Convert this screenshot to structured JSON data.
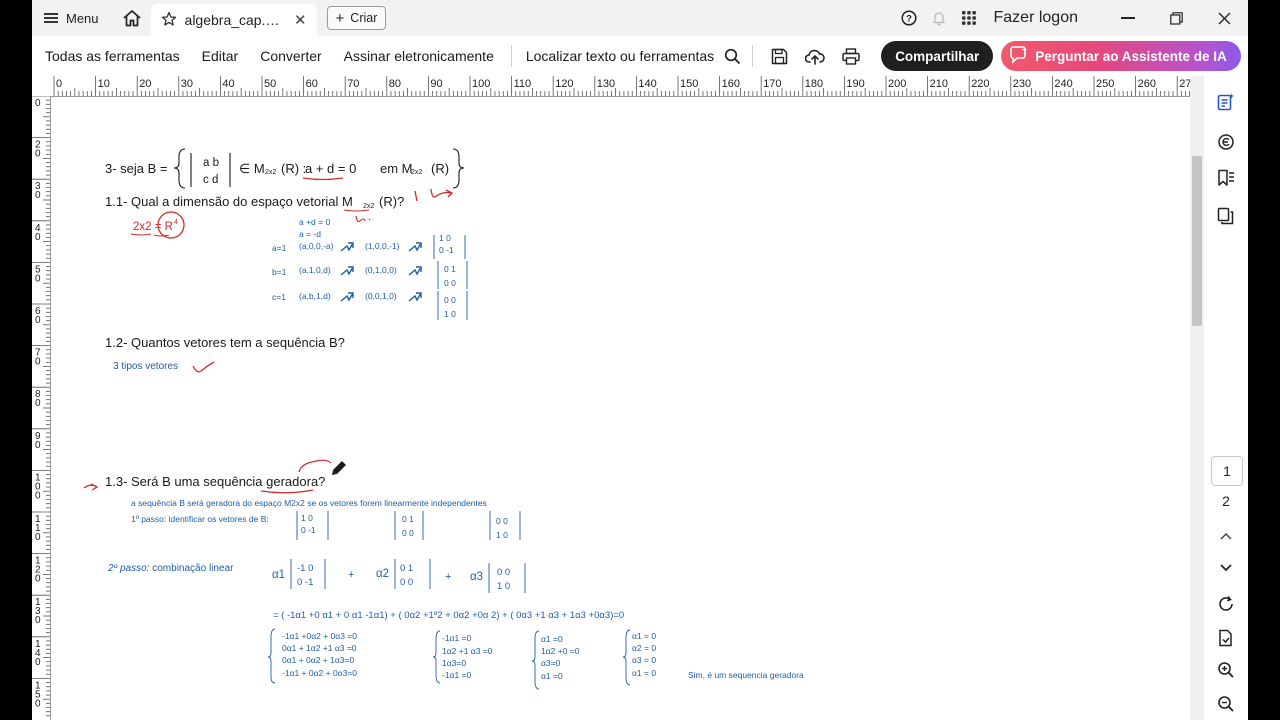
{
  "titlebar": {
    "menu_label": "Menu",
    "tab_label": "algebra_cap.3_aula ...",
    "new_label": "Criar",
    "signin_label": "Fazer logon"
  },
  "toolbar": {
    "items": [
      "Todas as ferramentas",
      "Editar",
      "Converter",
      "Assinar eletronicamente"
    ],
    "search_label": "Localizar texto ou ferramentas",
    "share_label": "Compartilhar",
    "ai_label": "Perguntar ao Assistente de IA"
  },
  "ruler": {
    "h_marks": [
      "0",
      "10",
      "20",
      "30",
      "40",
      "50",
      "60",
      "70",
      "80",
      "90",
      "100",
      "110",
      "120",
      "130",
      "140",
      "150",
      "160",
      "170",
      "180",
      "190",
      "200",
      "210",
      "220",
      "230",
      "240",
      "250",
      "260",
      "270"
    ],
    "v_marks": [
      "0",
      "20",
      "30",
      "40",
      "50",
      "60",
      "70",
      "80",
      "90",
      "100",
      "110",
      "120",
      "130",
      "140",
      "150"
    ]
  },
  "pages": {
    "current": "1",
    "next": "2"
  },
  "doc": {
    "q3_prefix": "3- seja B =",
    "q3_matrix_top": "a  b",
    "q3_matrix_bot": "c  d",
    "q3_in": "∈ M",
    "q3_sub": "2x2",
    "q3_r": "(R) :",
    "q3_cond": "a + d = 0",
    "q3_em": "em M",
    "q3_r2": "(R)",
    "q11": "1.1- Qual a dimensão do espaço vetorial M",
    "q11_sub": "2x2",
    "q11_r": "(R)?",
    "q11_answer": "2x2 = R",
    "q11_answer_sup": "4",
    "step_cond1": "a +d = 0",
    "step_cond2": "a = -d",
    "rows": [
      {
        "label": "a=1",
        "tuple": "(a,0,0,-a)",
        "vec": "(1,0,0,-1)",
        "m_top": "1  0",
        "m_bot": "0  -1"
      },
      {
        "label": "b=1",
        "tuple": "(a,1,0,d)",
        "vec": "(0,1,0,0)",
        "m_top": "0  1",
        "m_bot": "0  0"
      },
      {
        "label": "c=1",
        "tuple": "(a,b,1,d)",
        "vec": "(0,0,1,0)",
        "m_top": "0  0",
        "m_bot": "1  0"
      }
    ],
    "q12": "1.2- Quantos vetores tem a sequência B?",
    "q12_answer": "3 tipos vetores",
    "q13": "1.3- Será B uma sequência geradora?",
    "q13_note": "a sequência B será geradora do espaço M2x2 se os vetores forem linearmente independentes",
    "step1": "1º passo: identificar os vetores de B:",
    "b_vectors": [
      {
        "top": "1  0",
        "bot": "0  -1"
      },
      {
        "top": "0  1",
        "bot": "0  0"
      },
      {
        "top": "0  0",
        "bot": "1  0"
      }
    ],
    "step2_a": "2º passo:",
    "step2_b": " combinação linear",
    "lc_terms": [
      {
        "coef": "α1",
        "top": "-1  0",
        "bot": "0  -1"
      },
      {
        "coef": "α2",
        "top": "0  1",
        "bot": "0  0"
      },
      {
        "coef": "α3",
        "top": "0  0",
        "bot": "1  0"
      }
    ],
    "lc_plus": "+",
    "expansion": "= ( -1α1 +0 α1 + 0 α1  -1α1) + ( 0α2 +1º2 + 0α2 +0α 2) + ( 0α3 +1 α3 + 1α3 +0α3)=0",
    "sys1": [
      "-1α1 +0α2 + 0α3 =0",
      "0α1 + 1α2 +1 α3 =0",
      "0α1  + 0α2 + 1α3=0",
      "-1α1  + 0α2 + 0α3=0"
    ],
    "sys2": [
      "-1α1 =0",
      "1α2 +1 α3 =0",
      "1α3=0",
      "-1α1  =0"
    ],
    "sys3": [
      "α1 =0",
      "1α2 +0 =0",
      "α3=0",
      "α1  =0"
    ],
    "sys4": [
      "α1 = 0",
      "α2 = 0",
      "α3 = 0",
      "α1 = 0"
    ],
    "conclusion": "Sim, é um sequencia geradora"
  },
  "colors": {
    "ink_black": "#1a1a1a",
    "ink_blue": "#1f5fa8",
    "ink_red": "#d42a2a",
    "share_bg": "#1f1f1f"
  }
}
